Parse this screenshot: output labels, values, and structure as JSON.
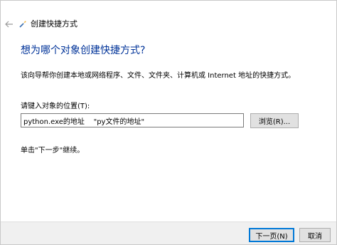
{
  "wizard": {
    "title": "创建快捷方式",
    "heading": "想为哪个对象创建快捷方式?",
    "description": "该向导帮你创建本地或网络程序、文件、文件夹、计算机或 Internet 地址的快捷方式。",
    "location_label": "请键入对象的位置(T):",
    "location_value": "python.exe的地址    \"py文件的地址\"",
    "browse_label": "浏览(R)...",
    "instruction": "单击\"下一步\"继续。"
  },
  "footer": {
    "next_label": "下一页(N)",
    "cancel_label": "取消"
  },
  "colors": {
    "heading": "#003399",
    "accent": "#0078d7",
    "footer_bg": "#f0f0f0"
  },
  "icons": {
    "back": "back-arrow-icon",
    "wizard": "shortcut-wizard-icon"
  }
}
